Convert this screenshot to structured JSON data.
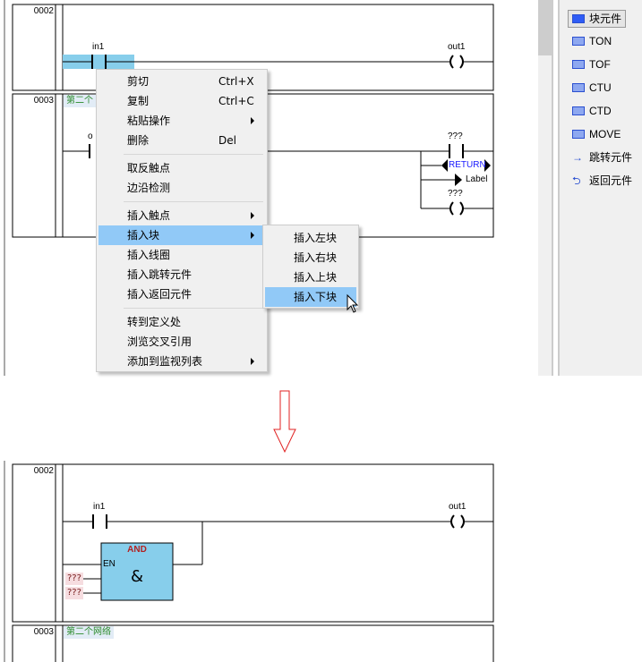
{
  "before": {
    "networks": [
      {
        "number": "0002",
        "contact": "in1",
        "coil": "out1"
      },
      {
        "number": "0003",
        "comment": "第二个",
        "contact_partial": "o",
        "contact2": "???",
        "return_label": "RETURN",
        "jump_label": "Label",
        "coil": "???"
      }
    ],
    "context_menu": {
      "items": [
        {
          "label": "剪切",
          "shortcut": "Ctrl+X"
        },
        {
          "label": "复制",
          "shortcut": "Ctrl+C"
        },
        {
          "label": "粘贴操作",
          "submenu": true
        },
        {
          "label": "删除",
          "shortcut": "Del"
        },
        {
          "label": "取反触点"
        },
        {
          "label": "边沿检测"
        },
        {
          "label": "插入触点",
          "submenu": true
        },
        {
          "label": "插入块",
          "submenu": true,
          "highlighted": true
        },
        {
          "label": "插入线圈"
        },
        {
          "label": "插入跳转元件"
        },
        {
          "label": "插入返回元件"
        },
        {
          "label": "转到定义处"
        },
        {
          "label": "浏览交叉引用"
        },
        {
          "label": "添加到监视列表",
          "submenu": true
        }
      ],
      "submenu": [
        "插入左块",
        "插入右块",
        "插入上块",
        "插入下块"
      ],
      "submenu_highlighted": "插入下块"
    },
    "palette": [
      {
        "label": "块元件",
        "icon": "block-icon",
        "selected": true
      },
      {
        "label": "TON",
        "icon": "timer-on-icon"
      },
      {
        "label": "TOF",
        "icon": "timer-off-icon"
      },
      {
        "label": "CTU",
        "icon": "counter-up-icon"
      },
      {
        "label": "CTD",
        "icon": "counter-down-icon"
      },
      {
        "label": "MOVE",
        "icon": "move-icon"
      },
      {
        "label": "跳转元件",
        "icon": "jump-icon"
      },
      {
        "label": "返回元件",
        "icon": "return-icon"
      }
    ]
  },
  "after": {
    "networks": [
      {
        "number": "0002",
        "contact": "in1",
        "coil": "out1",
        "block": {
          "name": "AND",
          "symbol": "&",
          "en": "EN",
          "inputs": [
            "???",
            "???"
          ]
        }
      },
      {
        "number": "0003",
        "comment": "第二个网络"
      }
    ]
  },
  "colors": {
    "highlight": "#91c9f7",
    "block_fill": "#87ceeb",
    "block_title": "#b22222",
    "arrow": "#e02020",
    "comment": "#2a8a2a"
  }
}
